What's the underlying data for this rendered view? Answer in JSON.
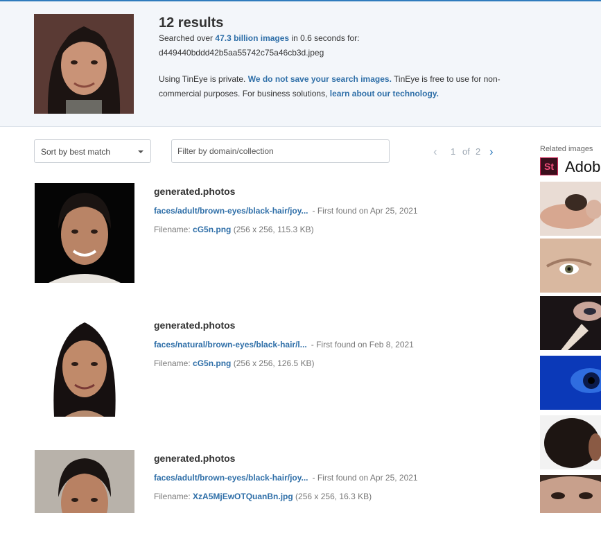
{
  "colors": {
    "accent": "#2f7bbd",
    "link": "#2f6fa8",
    "header_bg": "#f3f6fa"
  },
  "query": {
    "count_text": "12 results",
    "searched_prefix": "Searched over ",
    "searched_link": "47.3 billion images",
    "searched_suffix": " in 0.6 seconds for:",
    "filename": "d449440bddd42b5aa55742c75a46cb3d.jpeg",
    "privacy_prefix": "Using TinEye is private. ",
    "privacy_link": "We do not save your search images.",
    "privacy_mid": " TinEye is free to use for non-commercial purposes. For business solutions, ",
    "privacy_link2": "learn about our technology."
  },
  "controls": {
    "sort_label": "Sort by best match",
    "filter_placeholder": "Filter by domain/collection"
  },
  "pager": {
    "current": "1",
    "of": "of",
    "total": "2"
  },
  "results": [
    {
      "domain": "generated.photos",
      "path": "faces/adult/brown-eyes/black-hair/joy...",
      "first_found": "- First found on Apr 25, 2021",
      "filename_label": "Filename:",
      "filename": "cG5n.png",
      "meta": "(256 x 256, 115.3 KB)"
    },
    {
      "domain": "generated.photos",
      "path": "faces/natural/brown-eyes/black-hair/l...",
      "first_found": "- First found on Feb 8, 2021",
      "filename_label": "Filename:",
      "filename": "cG5n.png",
      "meta": "(256 x 256, 126.5 KB)"
    },
    {
      "domain": "generated.photos",
      "path": "faces/adult/brown-eyes/black-hair/joy...",
      "first_found": "- First found on Apr 25, 2021",
      "filename_label": "Filename:",
      "filename": "XzA5MjEwOTQuanBn.jpg",
      "meta": "(256 x 256, 16.3 KB)"
    }
  ],
  "sidebar": {
    "title": "Related images",
    "brand_badge": "St",
    "brand_name": "Adobe Stock"
  }
}
